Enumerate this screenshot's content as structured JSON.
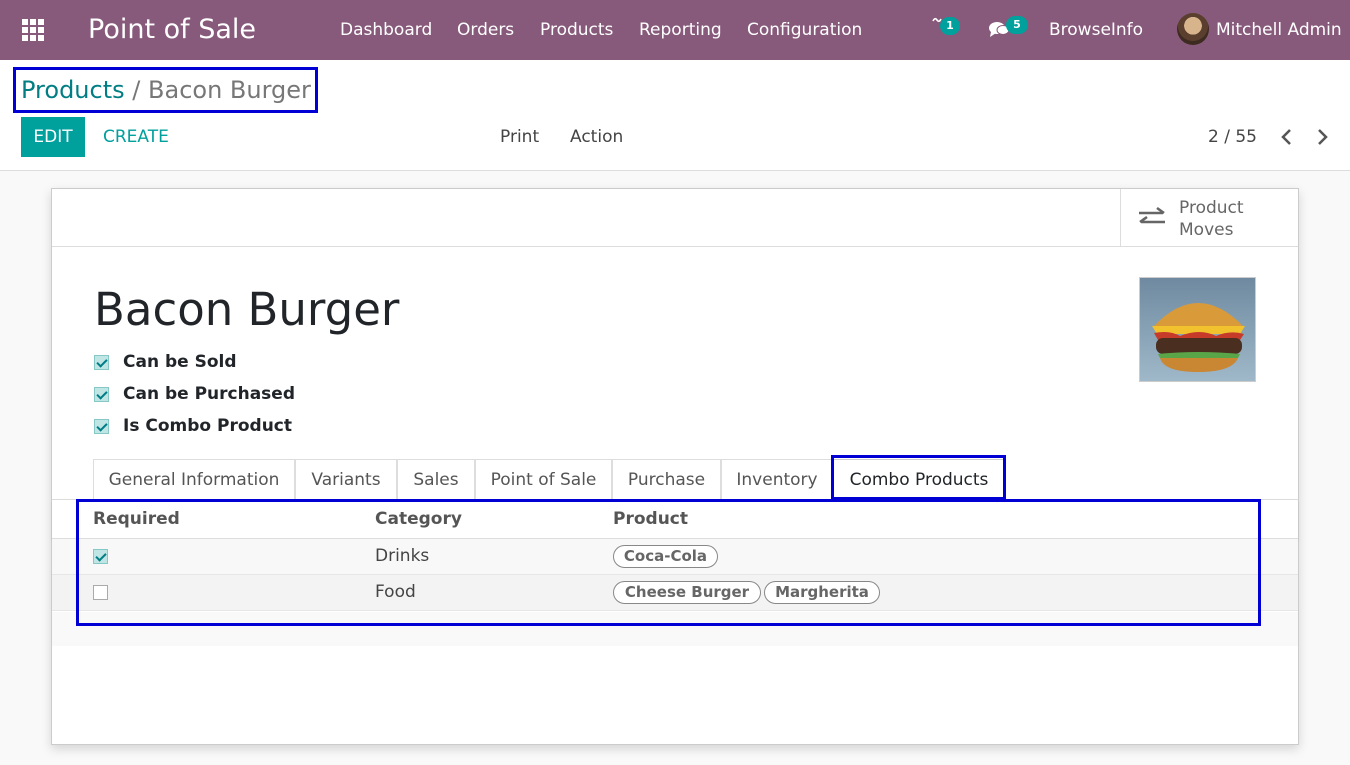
{
  "navbar": {
    "app_title": "Point of Sale",
    "menu": [
      "Dashboard",
      "Orders",
      "Products",
      "Reporting",
      "Configuration"
    ],
    "activity_count": "1",
    "message_count": "5",
    "company": "BrowseInfo",
    "user": "Mitchell Admin"
  },
  "control_panel": {
    "breadcrumb_parent": "Products",
    "breadcrumb_sep": "/",
    "breadcrumb_current": "Bacon Burger",
    "edit_label": "EDIT",
    "create_label": "CREATE",
    "print_label": "Print",
    "action_label": "Action",
    "pager": "2 / 55"
  },
  "smart_button": {
    "line1": "Product",
    "line2": "Moves"
  },
  "product": {
    "name": "Bacon Burger",
    "flags": [
      {
        "label": "Can be Sold",
        "checked": true
      },
      {
        "label": "Can be Purchased",
        "checked": true
      },
      {
        "label": "Is Combo Product",
        "checked": true
      }
    ]
  },
  "tabs": [
    "General Information",
    "Variants",
    "Sales",
    "Point of Sale",
    "Purchase",
    "Inventory",
    "Combo Products"
  ],
  "active_tab": "Combo Products",
  "combo_table": {
    "headers": [
      "Required",
      "Category",
      "Product"
    ],
    "rows": [
      {
        "required": true,
        "category": "Drinks",
        "products": [
          "Coca-Cola"
        ]
      },
      {
        "required": false,
        "category": "Food",
        "products": [
          "Cheese Burger",
          "Margherita"
        ]
      }
    ]
  },
  "colors": {
    "navbar": "#875a7b",
    "primary": "#00a09d",
    "link": "#017e84",
    "highlight": "#0000d4"
  },
  "icons": {
    "apps": "grid-icon",
    "activity": "clock-icon",
    "messages": "chat-icon",
    "moves": "exchange-icon",
    "prev": "chevron-left-icon",
    "next": "chevron-right-icon"
  }
}
